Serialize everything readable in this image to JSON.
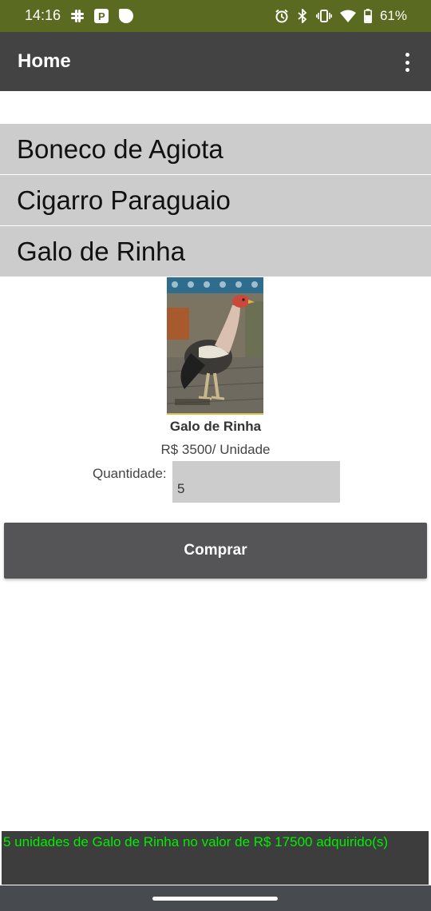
{
  "status_bar": {
    "time": "14:16",
    "battery": "61%",
    "left_icons": [
      "slack-icon",
      "parking-icon",
      "circle-icon"
    ],
    "right_icons": [
      "alarm-icon",
      "bluetooth-icon",
      "vibrate-icon",
      "wifi-icon",
      "battery-icon"
    ]
  },
  "app_bar": {
    "title": "Home",
    "menu_icon": "more-vert-icon"
  },
  "products": [
    {
      "label": "Boneco de Agiota"
    },
    {
      "label": "Cigarro Paraguaio"
    },
    {
      "label": "Galo de Rinha"
    }
  ],
  "detail": {
    "image": "rooster-photo",
    "name": "Galo de Rinha",
    "price": "R$ 3500/ Unidade",
    "quantity_label": "Quantidade:",
    "quantity_value": "5",
    "buy_label": "Comprar"
  },
  "message": "5 unidades de Galo de Rinha no valor de R$ 17500 adquirido(s)",
  "colors": {
    "status_bar": "#5a6b21",
    "app_bar": "#434343",
    "list_item": "#cccccc",
    "button": "#555557",
    "message_text": "#00ee00"
  }
}
